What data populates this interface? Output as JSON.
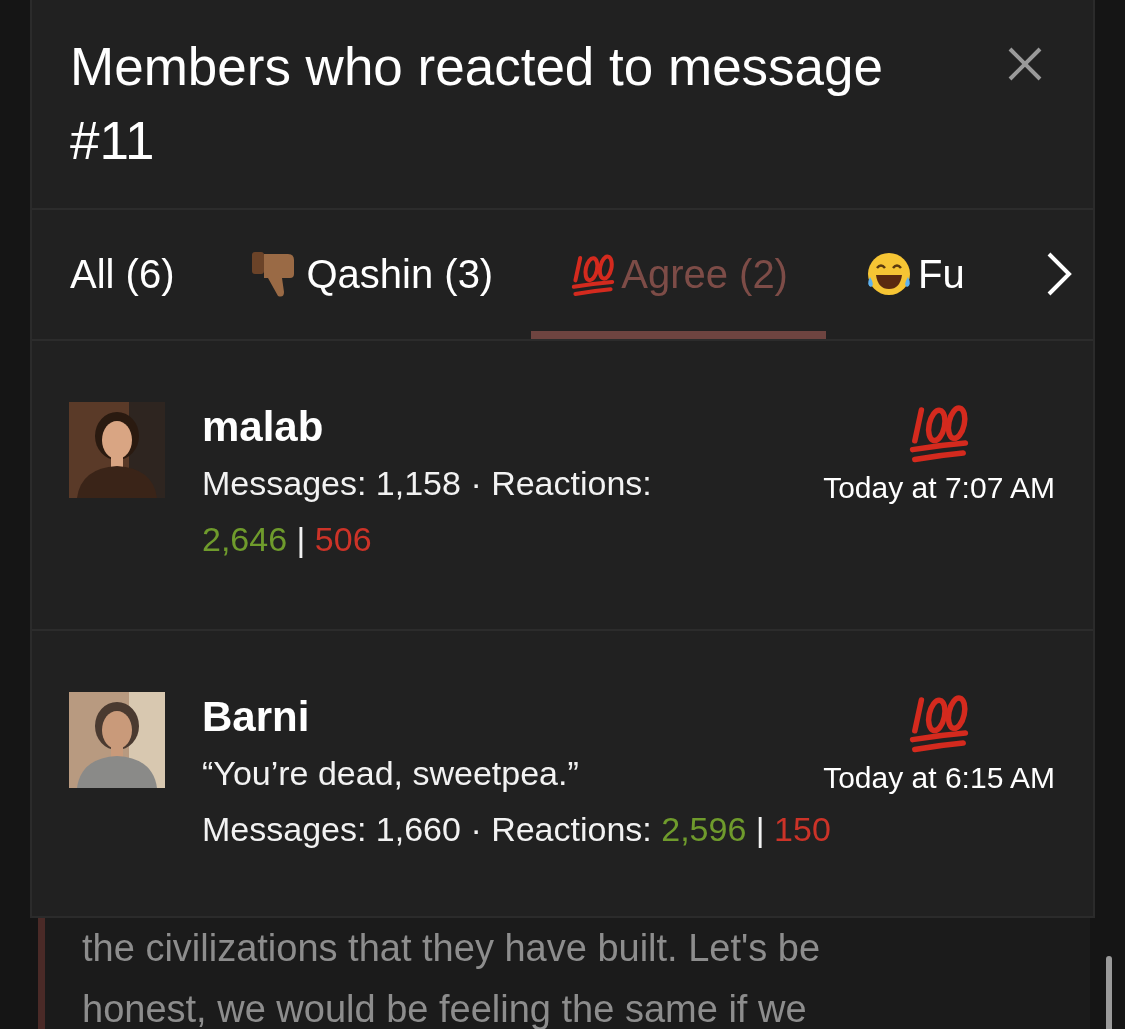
{
  "dialog": {
    "title": "Members who reacted to message #11"
  },
  "tabs": [
    {
      "label": "All (6)",
      "kind": "plain",
      "selected": false
    },
    {
      "label": "Qashin (3)",
      "kind": "dislike",
      "selected": false
    },
    {
      "label": "Agree (2)",
      "kind": "agree",
      "selected": true
    },
    {
      "label": "Fu",
      "kind": "funny",
      "selected": false
    }
  ],
  "members": [
    {
      "name": "malab",
      "stats": "Messages: 1,158 · Reactions:",
      "positive": "2,646",
      "separator": "|",
      "negative": "506",
      "time": "Today at 7:07 AM"
    },
    {
      "name": "Barni",
      "quote": "“You’re dead, sweetpea.”",
      "stats": "Messages: 1,660 · Reactions:",
      "positive": "2,596",
      "separator": "|",
      "negative": "150",
      "time": "Today at 6:15 AM"
    }
  ],
  "background_post": {
    "lines": [
      "the civilizations that they have built. Let's be",
      "honest, we would be feeling the same if we"
    ]
  }
}
